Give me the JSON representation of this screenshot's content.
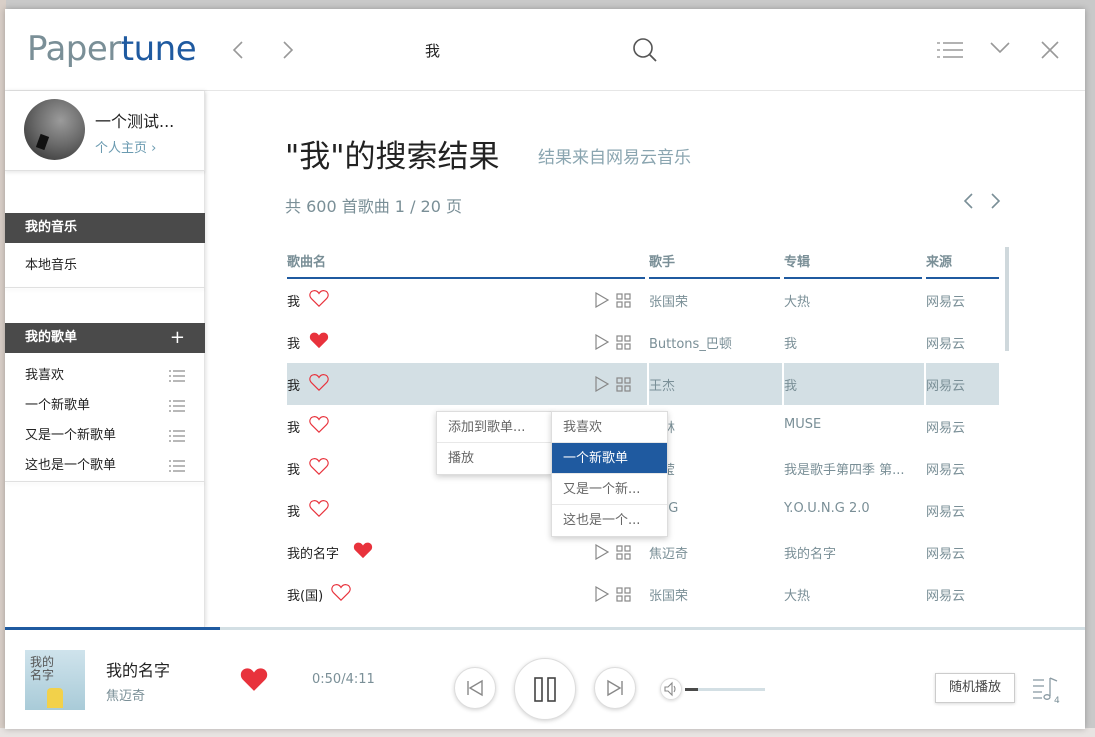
{
  "app": {
    "logo_part1": "Paper",
    "logo_part2": "tune"
  },
  "header": {
    "search_query": "我"
  },
  "profile": {
    "username": "一个测试...",
    "link": "个人主页 ›"
  },
  "sidebar": {
    "my_music_header": "我的音乐",
    "local_music": "本地音乐",
    "my_playlists_header": "我的歌单",
    "add_icon": "+",
    "playlists": [
      "我喜欢",
      "一个新歌单",
      "又是一个新歌单",
      "这也是一个歌单"
    ]
  },
  "main": {
    "title": "\"我\"的搜索结果",
    "subtitle": "结果来自网易云音乐",
    "count_text": "共 600 首歌曲  1 / 20 页",
    "columns": [
      "歌曲名",
      "歌手",
      "专辑",
      "来源"
    ],
    "rows": [
      {
        "name": "我",
        "liked": false,
        "artist": "张国荣",
        "album": "大热",
        "source": "网易云"
      },
      {
        "name": "我",
        "liked": true,
        "artist": "Buttons_巴顿",
        "album": "我",
        "source": "网易云"
      },
      {
        "name": "我",
        "liked": false,
        "artist": "王杰",
        "album": "我",
        "source": "网易云",
        "highlighted": true
      },
      {
        "name": "我",
        "liked": false,
        "artist": "依林",
        "album": "MUSE",
        "source": "网易云"
      },
      {
        "name": "我",
        "liked": false,
        "artist": "运莹",
        "album": "我是歌手第四季 第...",
        "source": "网易云"
      },
      {
        "name": "我",
        "liked": false,
        "artist": "UNG",
        "album": "Y.O.U.N.G 2.0",
        "source": "网易云"
      },
      {
        "name": "我的名字",
        "liked": true,
        "artist": "焦迈奇",
        "album": "我的名字",
        "source": "网易云"
      },
      {
        "name": "我(国)",
        "liked": false,
        "artist": "张国荣",
        "album": "大热",
        "source": "网易云"
      }
    ]
  },
  "context_menu": {
    "items": [
      "添加到歌单...",
      "播放"
    ],
    "submenu": [
      "我喜欢",
      "一个新歌单",
      "又是一个新...",
      "这也是一个..."
    ],
    "selected_submenu_index": 1
  },
  "player": {
    "title": "我的名字",
    "artist": "焦迈奇",
    "cover_text": "我的\n名字",
    "time": "0:50/4:11",
    "progress": 0.199,
    "volume": 0.16,
    "mode_label": "随机播放",
    "queue_count": "4"
  },
  "colors": {
    "accent": "#1f5aa0",
    "heart": "#e8323c",
    "muted": "#7a8f97",
    "highlight": "#d3dfe4",
    "dark": "#4a4a4a"
  }
}
